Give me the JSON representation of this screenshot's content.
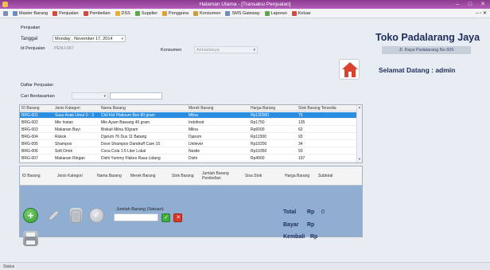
{
  "window": {
    "title": "Halaman Utama - [Transaksi Penjualan]"
  },
  "menu": [
    {
      "label": "Master Barang",
      "color": "#6b8cc4"
    },
    {
      "label": "Penjualan",
      "color": "#d24b3e"
    },
    {
      "label": "Pembelian",
      "color": "#d24b3e"
    },
    {
      "label": "DSS",
      "color": "#e8b030"
    },
    {
      "label": "Supplier",
      "color": "#5aa84a"
    },
    {
      "label": "Pengguna",
      "color": "#e0a030"
    },
    {
      "label": "Konsumen",
      "color": "#c8a040"
    },
    {
      "label": "SMS Gateway",
      "color": "#6b8cc4"
    },
    {
      "label": "Laporan",
      "color": "#5aa84a"
    },
    {
      "label": "Keluar",
      "color": "#d24b3e"
    }
  ],
  "form": {
    "section_title": "Penjualan",
    "tanggal_label": "Tanggal",
    "tanggal_day": "Monday",
    "tanggal_date": "November 17, 2014",
    "id_label": "Id Penjualan",
    "id_value": "PENJ-067",
    "konsumen_label": "Konsumen",
    "konsumen_value": "Annastasya",
    "daftar_title": "Daftar Penjualan",
    "cari_label": "Cari Berdasarkan"
  },
  "brand": {
    "title": "Toko Padalarang Jaya",
    "address": "Jl. Raya Padalarang No 605",
    "greeting": "Selamat Datang : admin"
  },
  "products": {
    "headers": [
      "ID Barang",
      "Jenis Kategori",
      "Nama Barang",
      "Merek Barang",
      "Harga Barang",
      "Stok Barang Tersedia"
    ],
    "rows": [
      [
        "BRG-001",
        "Susu Anak Umur 0 - 3",
        "Chil Kid Platinum Box 80 gram",
        "Milna",
        "Rp130000",
        "75"
      ],
      [
        "BRG-002",
        "Mie Instan",
        "Mie Ayam Bawang 45 gram",
        "Indofood",
        "Rp1750",
        "135"
      ],
      [
        "BRG-003",
        "Makanan Bayi",
        "Biskuit Milna 50gram",
        "Milna",
        "Rp6000",
        "62"
      ],
      [
        "BRG-004",
        "Rokok",
        "Djarum 76 Dus 11 Batang",
        "Djarum",
        "Rp11500",
        "93"
      ],
      [
        "BRG-005",
        "Shampoo",
        "Dove Shampoo Dandruff Care 16",
        "Unilever",
        "Rp10200",
        "34"
      ],
      [
        "BRG-006",
        "Soft Drink",
        "Coca Cola 1.5 Liter Lokal",
        "Nestle",
        "Rp10350",
        "93"
      ],
      [
        "BRG-007",
        "Makanan Ringan",
        "Dishi Yummy Flakes Rasa Lidang",
        "Dishi",
        "Rp4900",
        "197"
      ]
    ]
  },
  "cart": {
    "headers": [
      "ID Barang",
      "Jenis Kategori",
      "Nama Barang",
      "Merek Barang",
      "Stok Barang",
      "Jumlah Barang Pembelian",
      "Sisa Stok",
      "Harga Barang",
      "Subtotal"
    ]
  },
  "qty": {
    "label": "Jumlah Barang (Satuan)"
  },
  "totals": {
    "total_label": "Total",
    "bayar_label": "Bayar",
    "kembali_label": "Kembali",
    "currency": "Rp",
    "total_value": "0"
  },
  "status": {
    "text": "Status"
  }
}
